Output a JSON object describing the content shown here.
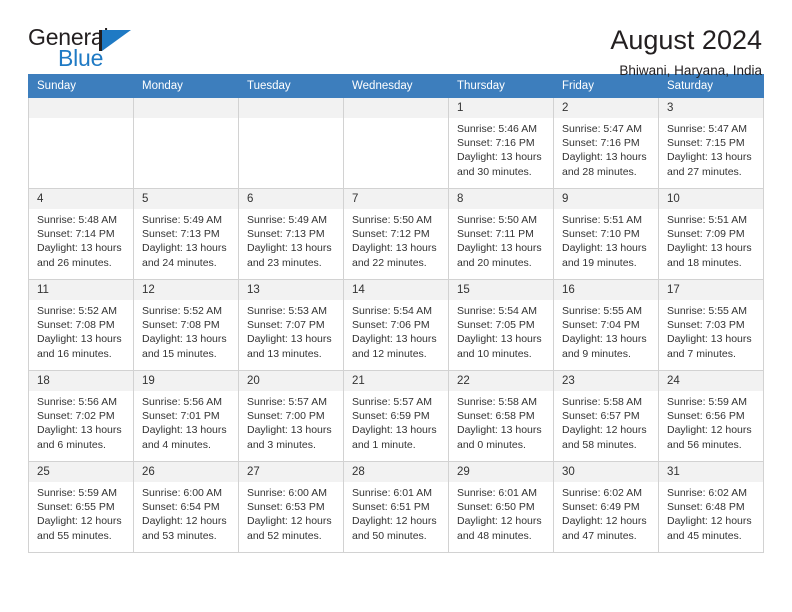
{
  "brand": {
    "name_part1": "General",
    "name_part2": "Blue",
    "accent_color": "#1f7ac4"
  },
  "header": {
    "title": "August 2024",
    "subtitle": "Bhiwani, Haryana, India"
  },
  "calendar": {
    "header_bg": "#3d7ebd",
    "weekdays": [
      "Sunday",
      "Monday",
      "Tuesday",
      "Wednesday",
      "Thursday",
      "Friday",
      "Saturday"
    ],
    "weeks": [
      [
        {
          "day": "",
          "empty": true
        },
        {
          "day": "",
          "empty": true
        },
        {
          "day": "",
          "empty": true
        },
        {
          "day": "",
          "empty": true
        },
        {
          "day": "1",
          "sunrise": "Sunrise: 5:46 AM",
          "sunset": "Sunset: 7:16 PM",
          "daylight1": "Daylight: 13 hours",
          "daylight2": "and 30 minutes."
        },
        {
          "day": "2",
          "sunrise": "Sunrise: 5:47 AM",
          "sunset": "Sunset: 7:16 PM",
          "daylight1": "Daylight: 13 hours",
          "daylight2": "and 28 minutes."
        },
        {
          "day": "3",
          "sunrise": "Sunrise: 5:47 AM",
          "sunset": "Sunset: 7:15 PM",
          "daylight1": "Daylight: 13 hours",
          "daylight2": "and 27 minutes."
        }
      ],
      [
        {
          "day": "4",
          "sunrise": "Sunrise: 5:48 AM",
          "sunset": "Sunset: 7:14 PM",
          "daylight1": "Daylight: 13 hours",
          "daylight2": "and 26 minutes."
        },
        {
          "day": "5",
          "sunrise": "Sunrise: 5:49 AM",
          "sunset": "Sunset: 7:13 PM",
          "daylight1": "Daylight: 13 hours",
          "daylight2": "and 24 minutes."
        },
        {
          "day": "6",
          "sunrise": "Sunrise: 5:49 AM",
          "sunset": "Sunset: 7:13 PM",
          "daylight1": "Daylight: 13 hours",
          "daylight2": "and 23 minutes."
        },
        {
          "day": "7",
          "sunrise": "Sunrise: 5:50 AM",
          "sunset": "Sunset: 7:12 PM",
          "daylight1": "Daylight: 13 hours",
          "daylight2": "and 22 minutes."
        },
        {
          "day": "8",
          "sunrise": "Sunrise: 5:50 AM",
          "sunset": "Sunset: 7:11 PM",
          "daylight1": "Daylight: 13 hours",
          "daylight2": "and 20 minutes."
        },
        {
          "day": "9",
          "sunrise": "Sunrise: 5:51 AM",
          "sunset": "Sunset: 7:10 PM",
          "daylight1": "Daylight: 13 hours",
          "daylight2": "and 19 minutes."
        },
        {
          "day": "10",
          "sunrise": "Sunrise: 5:51 AM",
          "sunset": "Sunset: 7:09 PM",
          "daylight1": "Daylight: 13 hours",
          "daylight2": "and 18 minutes."
        }
      ],
      [
        {
          "day": "11",
          "sunrise": "Sunrise: 5:52 AM",
          "sunset": "Sunset: 7:08 PM",
          "daylight1": "Daylight: 13 hours",
          "daylight2": "and 16 minutes."
        },
        {
          "day": "12",
          "sunrise": "Sunrise: 5:52 AM",
          "sunset": "Sunset: 7:08 PM",
          "daylight1": "Daylight: 13 hours",
          "daylight2": "and 15 minutes."
        },
        {
          "day": "13",
          "sunrise": "Sunrise: 5:53 AM",
          "sunset": "Sunset: 7:07 PM",
          "daylight1": "Daylight: 13 hours",
          "daylight2": "and 13 minutes."
        },
        {
          "day": "14",
          "sunrise": "Sunrise: 5:54 AM",
          "sunset": "Sunset: 7:06 PM",
          "daylight1": "Daylight: 13 hours",
          "daylight2": "and 12 minutes."
        },
        {
          "day": "15",
          "sunrise": "Sunrise: 5:54 AM",
          "sunset": "Sunset: 7:05 PM",
          "daylight1": "Daylight: 13 hours",
          "daylight2": "and 10 minutes."
        },
        {
          "day": "16",
          "sunrise": "Sunrise: 5:55 AM",
          "sunset": "Sunset: 7:04 PM",
          "daylight1": "Daylight: 13 hours",
          "daylight2": "and 9 minutes."
        },
        {
          "day": "17",
          "sunrise": "Sunrise: 5:55 AM",
          "sunset": "Sunset: 7:03 PM",
          "daylight1": "Daylight: 13 hours",
          "daylight2": "and 7 minutes."
        }
      ],
      [
        {
          "day": "18",
          "sunrise": "Sunrise: 5:56 AM",
          "sunset": "Sunset: 7:02 PM",
          "daylight1": "Daylight: 13 hours",
          "daylight2": "and 6 minutes."
        },
        {
          "day": "19",
          "sunrise": "Sunrise: 5:56 AM",
          "sunset": "Sunset: 7:01 PM",
          "daylight1": "Daylight: 13 hours",
          "daylight2": "and 4 minutes."
        },
        {
          "day": "20",
          "sunrise": "Sunrise: 5:57 AM",
          "sunset": "Sunset: 7:00 PM",
          "daylight1": "Daylight: 13 hours",
          "daylight2": "and 3 minutes."
        },
        {
          "day": "21",
          "sunrise": "Sunrise: 5:57 AM",
          "sunset": "Sunset: 6:59 PM",
          "daylight1": "Daylight: 13 hours",
          "daylight2": "and 1 minute."
        },
        {
          "day": "22",
          "sunrise": "Sunrise: 5:58 AM",
          "sunset": "Sunset: 6:58 PM",
          "daylight1": "Daylight: 13 hours",
          "daylight2": "and 0 minutes."
        },
        {
          "day": "23",
          "sunrise": "Sunrise: 5:58 AM",
          "sunset": "Sunset: 6:57 PM",
          "daylight1": "Daylight: 12 hours",
          "daylight2": "and 58 minutes."
        },
        {
          "day": "24",
          "sunrise": "Sunrise: 5:59 AM",
          "sunset": "Sunset: 6:56 PM",
          "daylight1": "Daylight: 12 hours",
          "daylight2": "and 56 minutes."
        }
      ],
      [
        {
          "day": "25",
          "sunrise": "Sunrise: 5:59 AM",
          "sunset": "Sunset: 6:55 PM",
          "daylight1": "Daylight: 12 hours",
          "daylight2": "and 55 minutes."
        },
        {
          "day": "26",
          "sunrise": "Sunrise: 6:00 AM",
          "sunset": "Sunset: 6:54 PM",
          "daylight1": "Daylight: 12 hours",
          "daylight2": "and 53 minutes."
        },
        {
          "day": "27",
          "sunrise": "Sunrise: 6:00 AM",
          "sunset": "Sunset: 6:53 PM",
          "daylight1": "Daylight: 12 hours",
          "daylight2": "and 52 minutes."
        },
        {
          "day": "28",
          "sunrise": "Sunrise: 6:01 AM",
          "sunset": "Sunset: 6:51 PM",
          "daylight1": "Daylight: 12 hours",
          "daylight2": "and 50 minutes."
        },
        {
          "day": "29",
          "sunrise": "Sunrise: 6:01 AM",
          "sunset": "Sunset: 6:50 PM",
          "daylight1": "Daylight: 12 hours",
          "daylight2": "and 48 minutes."
        },
        {
          "day": "30",
          "sunrise": "Sunrise: 6:02 AM",
          "sunset": "Sunset: 6:49 PM",
          "daylight1": "Daylight: 12 hours",
          "daylight2": "and 47 minutes."
        },
        {
          "day": "31",
          "sunrise": "Sunrise: 6:02 AM",
          "sunset": "Sunset: 6:48 PM",
          "daylight1": "Daylight: 12 hours",
          "daylight2": "and 45 minutes."
        }
      ]
    ]
  }
}
